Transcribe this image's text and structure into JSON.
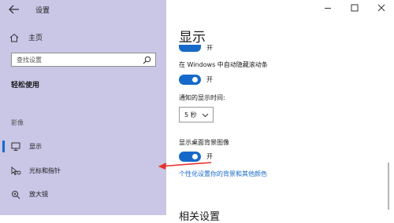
{
  "window": {
    "title": "设置",
    "back_icon": "arrow-left-icon",
    "minimize_icon": "minimize-icon",
    "maximize_icon": "maximize-icon",
    "close_icon": "close-icon"
  },
  "sidebar": {
    "home_label": "主页",
    "search_placeholder": "查找设置",
    "section_title": "轻松使用",
    "group_label": "影像",
    "items": [
      {
        "label": "显示",
        "icon": "monitor-icon",
        "selected": true
      },
      {
        "label": "光标和指针",
        "icon": "cursor-pointer-icon",
        "selected": false
      },
      {
        "label": "放大镜",
        "icon": "magnifier-icon",
        "selected": false
      }
    ]
  },
  "main": {
    "page_title": "显示",
    "top_toggle_state": "开",
    "scrollbar_setting": {
      "label": "在 Windows 中自动隐藏滚动条",
      "state": "开"
    },
    "notification_time": {
      "label": "通知的显示时间:",
      "value": "5 秒"
    },
    "desktop_background": {
      "label": "显示桌面背景图像",
      "state": "开"
    },
    "link": "个性化设置你的背景和其他颜色",
    "related_heading": "相关设置"
  },
  "colors": {
    "sidebar_bg": "#c9c6e6",
    "accent": "#1769c9",
    "annotation_arrow": "#e8312a"
  }
}
